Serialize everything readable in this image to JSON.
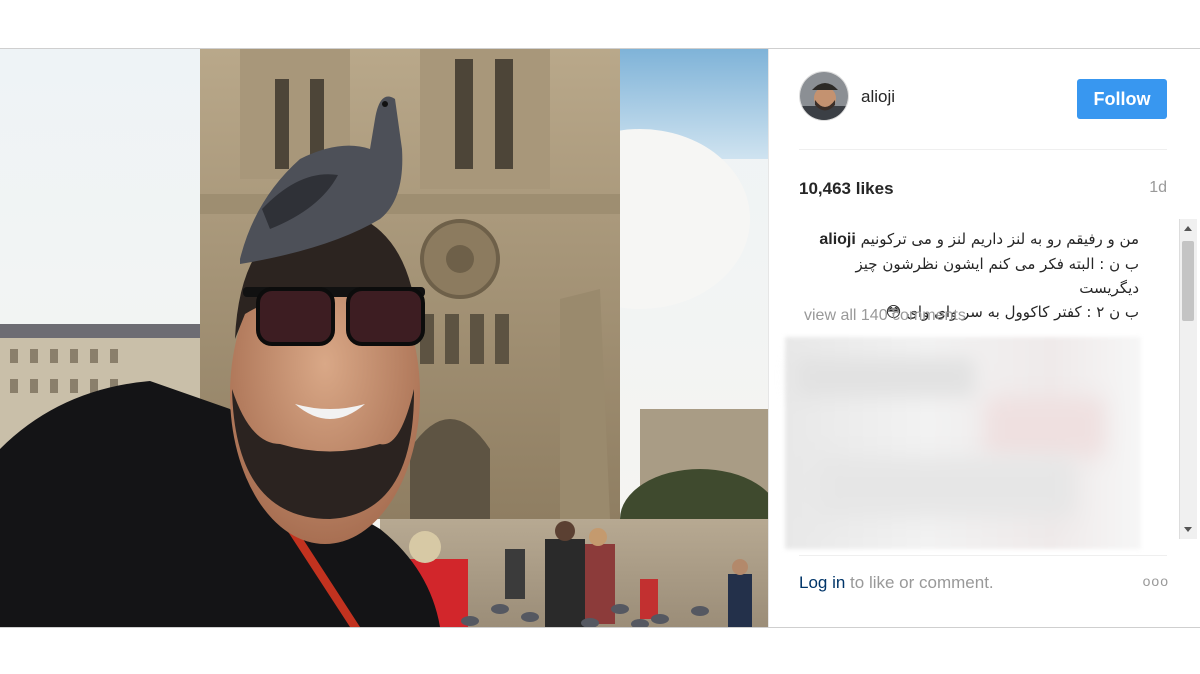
{
  "header": {
    "username": "alioji",
    "follow_label": "Follow"
  },
  "stats": {
    "likes": "10,463 likes",
    "time": "1d"
  },
  "caption": {
    "username": "alioji",
    "line1": "من و رفیقم رو به لنز داریم لنز و می ترکونیم",
    "line2": "ب ن : البته فکر می کنم ایشون نظرشون چیز دیگریست",
    "line3": "ب ن ۲ : کفتر کاکوول به سر وای وای",
    "emoji": "😳"
  },
  "comments": {
    "view_all": "view all 140 comments"
  },
  "footer": {
    "login_link": "Log in",
    "login_rest": " to like or comment.",
    "more": "ooo"
  },
  "colors": {
    "follow_bg": "#3897f0",
    "link": "#003569",
    "muted": "#999999"
  },
  "icons": {
    "more": "three-dots-icon"
  }
}
